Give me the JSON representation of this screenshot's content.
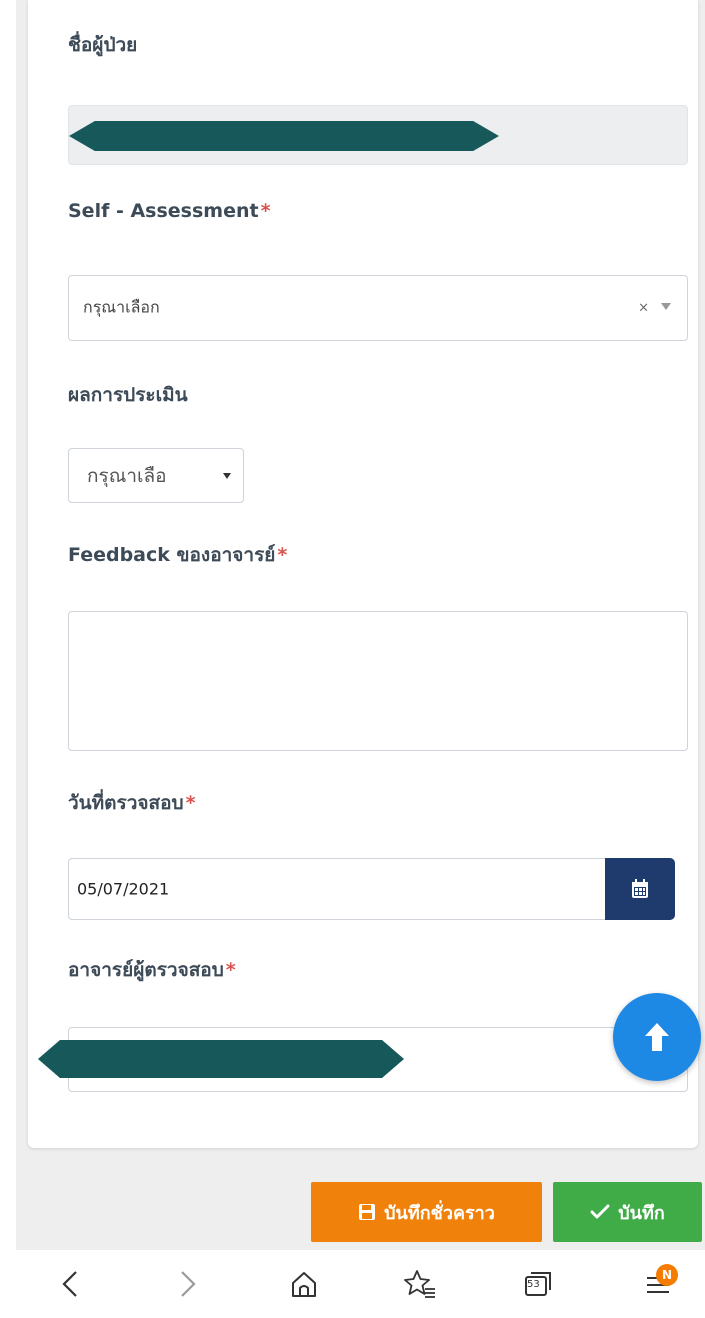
{
  "form": {
    "patient_name_label": "ชื่อผู้ป่วย",
    "self_assessment": {
      "label": "Self - Assessment",
      "required_mark": "*",
      "placeholder": "กรุณาเลือก",
      "clear_glyph": "×"
    },
    "evaluation_result": {
      "label": "ผลการประเมิน",
      "selected": "กรุณาเลือ"
    },
    "feedback": {
      "label": "Feedback ของอาจารย์",
      "required_mark": "*",
      "value": ""
    },
    "inspection_date": {
      "label": "วันที่ตรวจสอบ",
      "required_mark": "*",
      "value": "05/07/2021"
    },
    "inspector": {
      "label": "อาจารย์ผู้ตรวจสอบ",
      "required_mark": "*"
    }
  },
  "buttons": {
    "save_draft": "บันทึกชั่วคราว",
    "save": "บันทึก"
  },
  "browser_nav": {
    "tab_count": "53",
    "menu_badge": "N"
  },
  "colors": {
    "draft_button": "#f0810a",
    "save_button": "#3fac48",
    "calendar_button": "#1f3b6e",
    "scroll_top_button": "#1e88e5",
    "required_mark": "#d9534f",
    "redaction": "#17595b"
  },
  "icons": {
    "calendar": "calendar-icon",
    "scroll_top": "arrow-up-icon",
    "draft": "floppy-disk-icon",
    "save": "checkmark-icon",
    "nav": [
      "chevron-left-icon",
      "chevron-right-icon",
      "home-icon",
      "favorites-icon",
      "tabs-icon",
      "menu-icon"
    ]
  }
}
